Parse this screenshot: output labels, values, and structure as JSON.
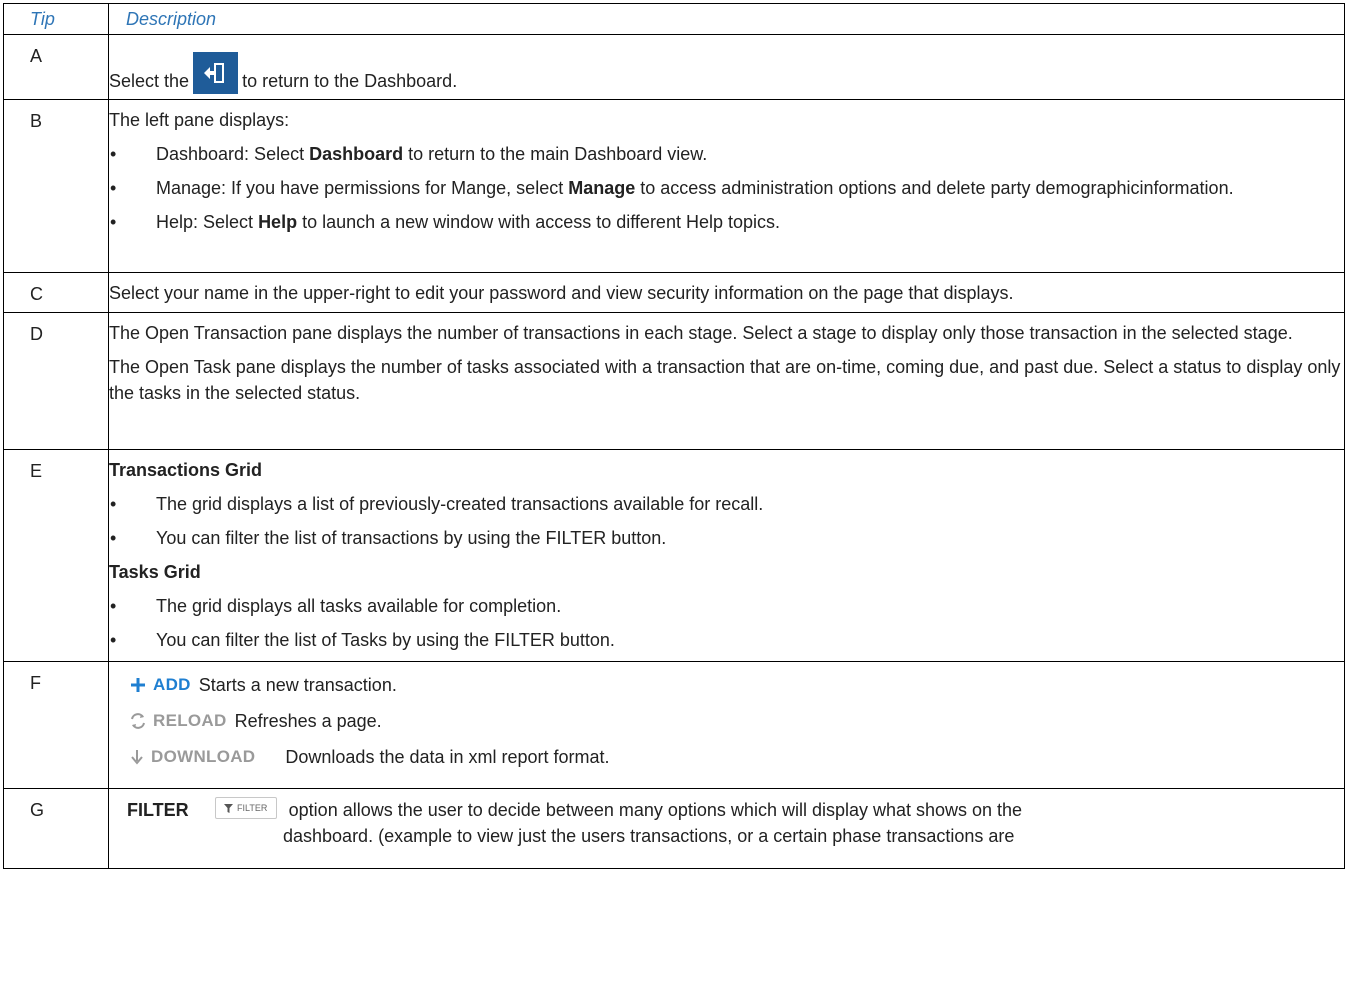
{
  "header": {
    "tip": "Tip",
    "description": "Description"
  },
  "rows": {
    "a": {
      "tip": "A",
      "pre": "Select the",
      "post": "to return to the Dashboard.",
      "icon": "exit-to-dashboard-icon"
    },
    "b": {
      "tip": "B",
      "intro": "The left pane displays:",
      "bullets": [
        {
          "pre": "Dashboard: Select ",
          "bold": "Dashboard",
          "post": " to return to the main Dashboard view."
        },
        {
          "pre": "Manage: If you have permissions for Mange, select ",
          "bold": "Manage",
          "post": " to access administration options and delete party demographicinformation."
        },
        {
          "pre": "Help: Select ",
          "bold": "Help",
          "post": " to launch a new window with access to different Help topics."
        }
      ]
    },
    "c": {
      "tip": "C",
      "text": "Select your name in the upper-right to edit your password and view security information on the page that displays."
    },
    "d": {
      "tip": "D",
      "p1": "The Open Transaction pane displays the number of transactions in each stage. Select a stage to display only those transaction in the selected stage.",
      "p2": "The Open Task pane displays the number of tasks associated with a transaction that are on-time, coming due, and past due. Select a status to display only the tasks in the selected status."
    },
    "e": {
      "tip": "E",
      "h1": "Transactions Grid",
      "b1": "The grid displays a list of previously-created transactions available for recall.",
      "b2": "You can filter the list of transactions by using the FILTER button.",
      "h2": "Tasks Grid",
      "b3": "The grid displays all tasks available for completion.",
      "b4": "You can filter the list of Tasks by using the FILTER button."
    },
    "f": {
      "tip": "F",
      "add_label": "ADD",
      "add_text": "Starts a new transaction.",
      "reload_label": "RELOAD",
      "reload_text": "Refreshes a page.",
      "download_label": "DOWNLOAD",
      "download_text": "Downloads the data in xml report format."
    },
    "g": {
      "tip": "G",
      "bold": "FILTER",
      "chip": "FILTER",
      "text1": "option allows the user to decide between many options which will display what shows on the",
      "text2": "dashboard. (example to view just the users transactions, or a certain phase transactions are"
    }
  },
  "bullet_char": "•",
  "colors": {
    "header": "#2e75b6",
    "add": "#1f7fd1",
    "icon_bg": "#1f5c99"
  }
}
